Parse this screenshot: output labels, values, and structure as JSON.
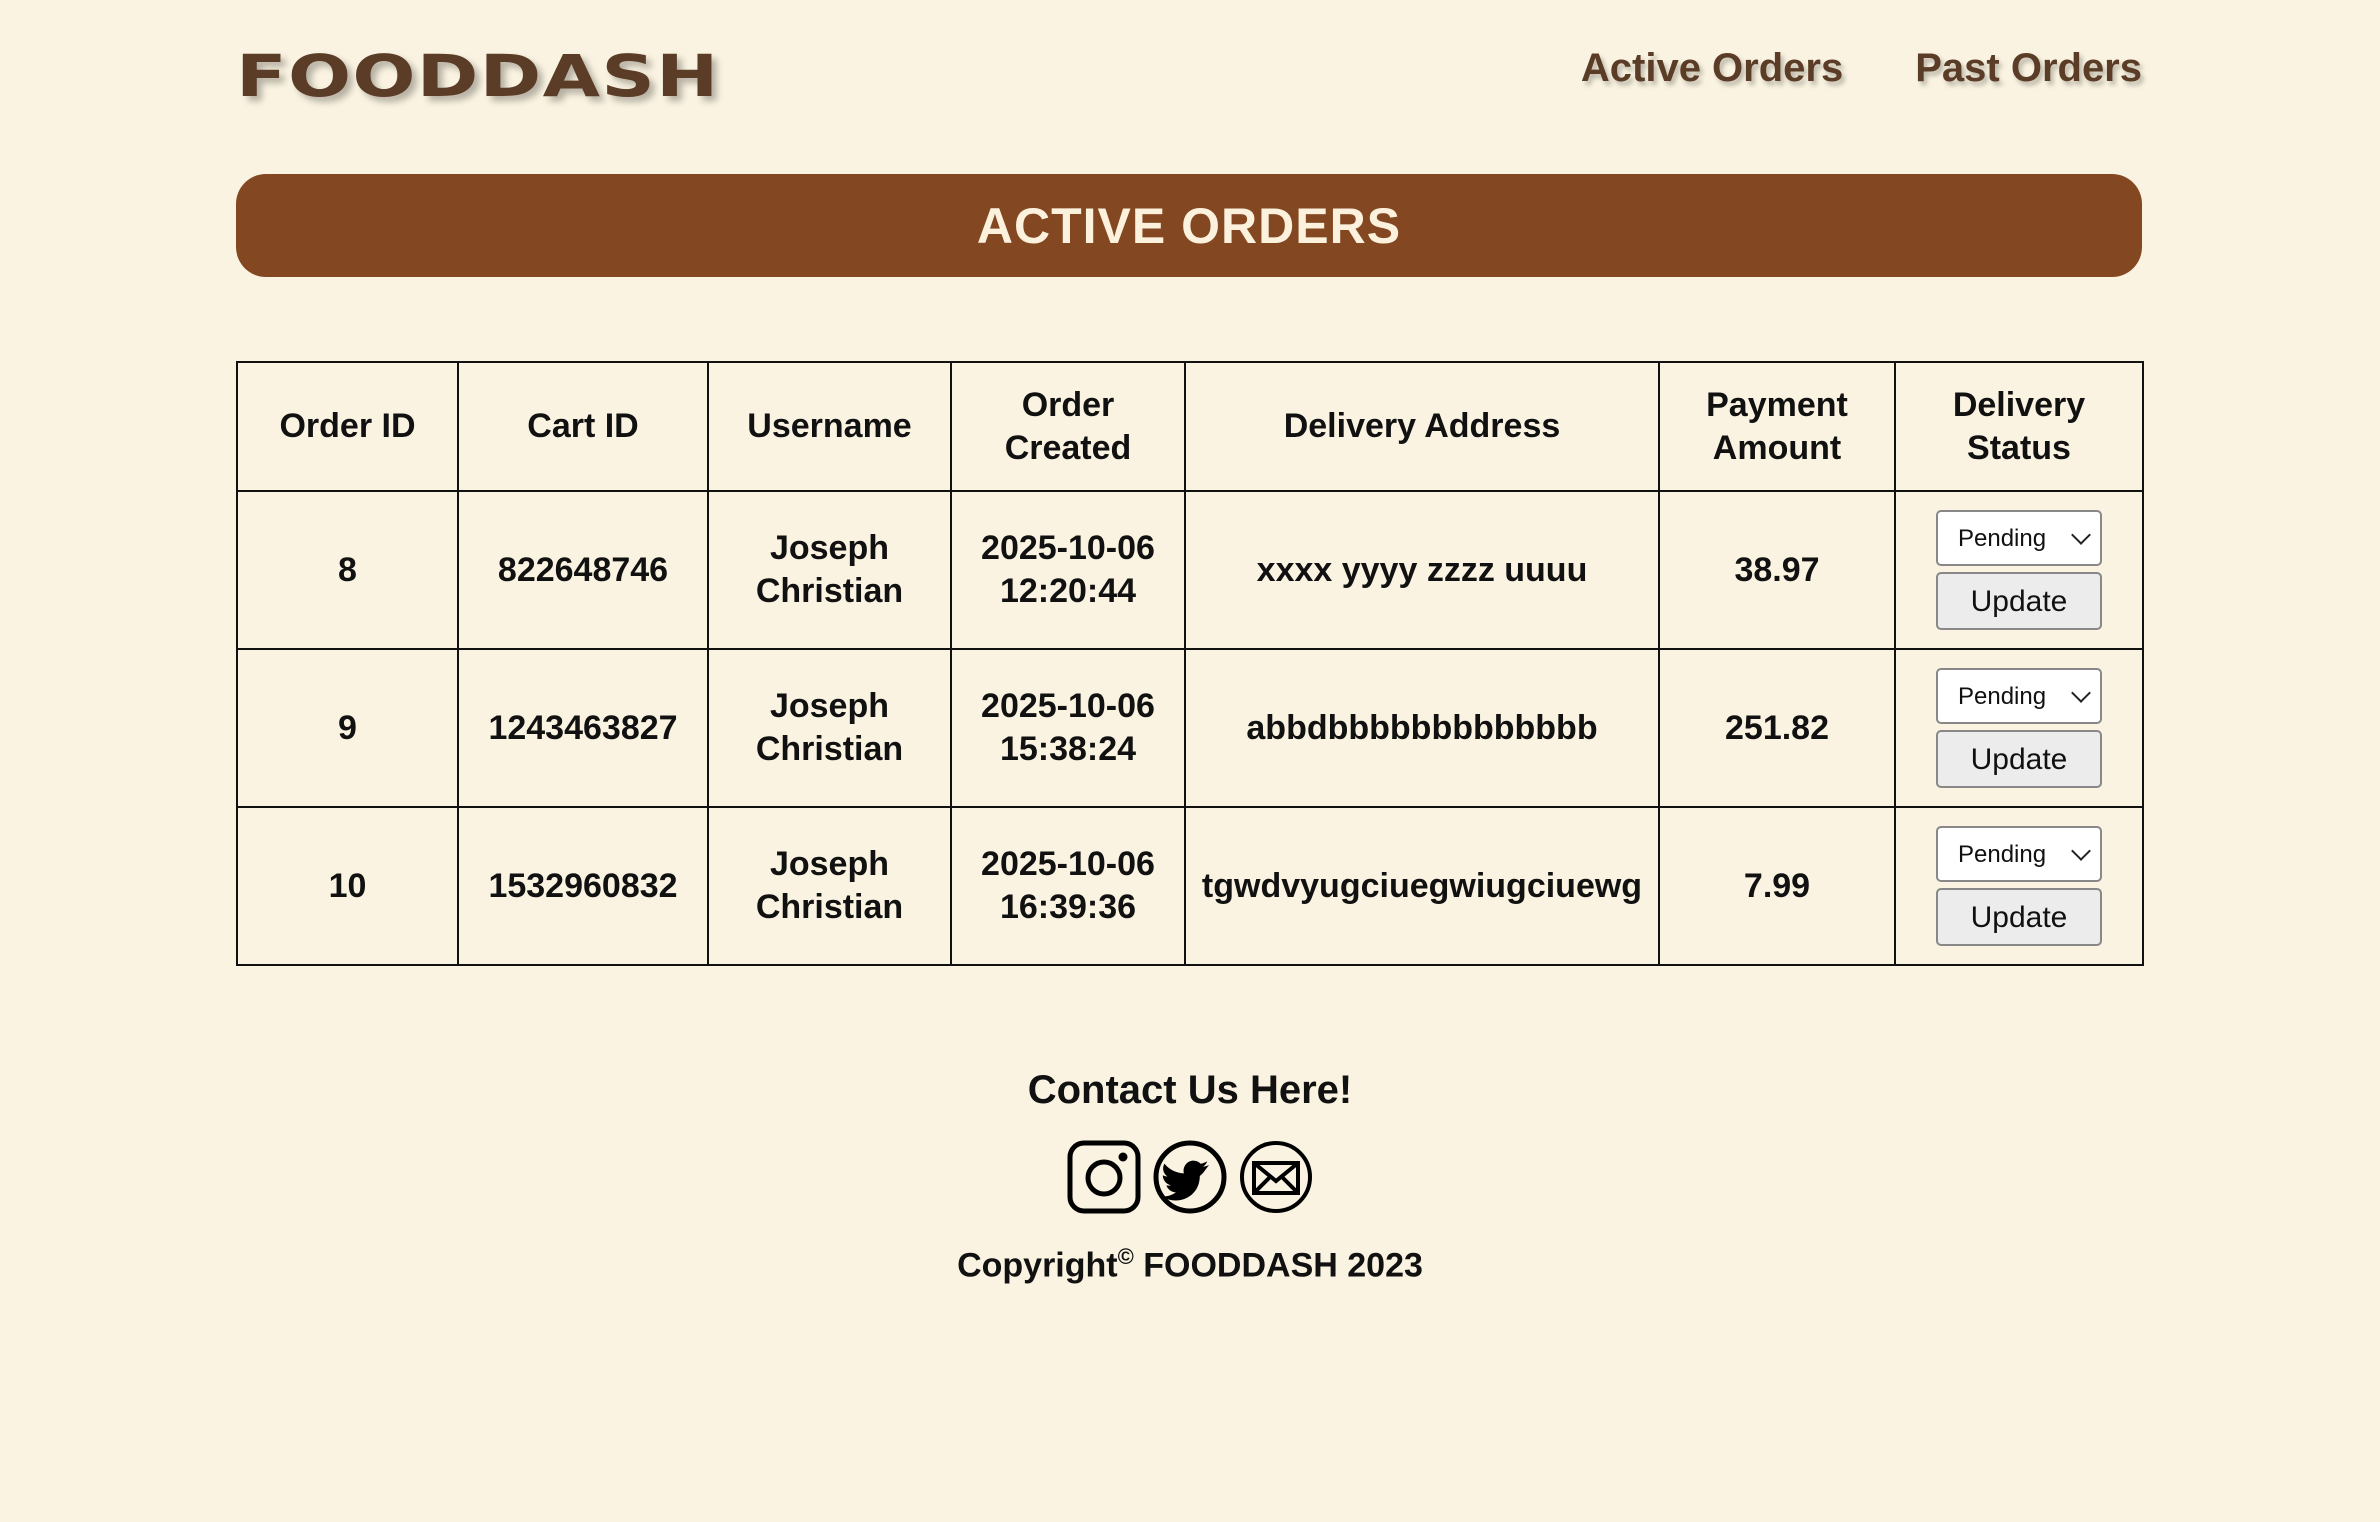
{
  "header": {
    "logo": "FOODDASH",
    "nav": [
      {
        "label": "Active Orders"
      },
      {
        "label": "Past Orders"
      }
    ]
  },
  "banner": {
    "title": "ACTIVE ORDERS"
  },
  "table": {
    "columns": [
      "Order ID",
      "Cart ID",
      "Username",
      "Order Created",
      "Delivery Address",
      "Payment Amount",
      "Delivery Status"
    ],
    "rows": [
      {
        "order_id": "8",
        "cart_id": "822648746",
        "username": "Joseph Christian",
        "created": "2025-10-06 12:20:44",
        "address": "xxxx yyyy zzzz uuuu",
        "amount": "38.97",
        "status": "Pending",
        "update_label": "Update"
      },
      {
        "order_id": "9",
        "cart_id": "1243463827",
        "username": "Joseph Christian",
        "created": "2025-10-06 15:38:24",
        "address": "abbdbbbbbbbbbbbbb",
        "amount": "251.82",
        "status": "Pending",
        "update_label": "Update"
      },
      {
        "order_id": "10",
        "cart_id": "1532960832",
        "username": "Joseph Christian",
        "created": "2025-10-06 16:39:36",
        "address": "tgwdvyugciuegwiugciuewg",
        "amount": "7.99",
        "status": "Pending",
        "update_label": "Update"
      }
    ]
  },
  "footer": {
    "contact_title": "Contact Us Here!",
    "icons": [
      "instagram-icon",
      "twitter-icon",
      "mail-icon"
    ],
    "copyright_prefix": "Copyright",
    "copyright_symbol": "©",
    "copyright_suffix": " FOODDASH 2023"
  },
  "colors": {
    "background": "#faf3e1",
    "brand_brown": "#5a3c27",
    "banner": "#834822",
    "banner_text": "#fbf1dc"
  }
}
